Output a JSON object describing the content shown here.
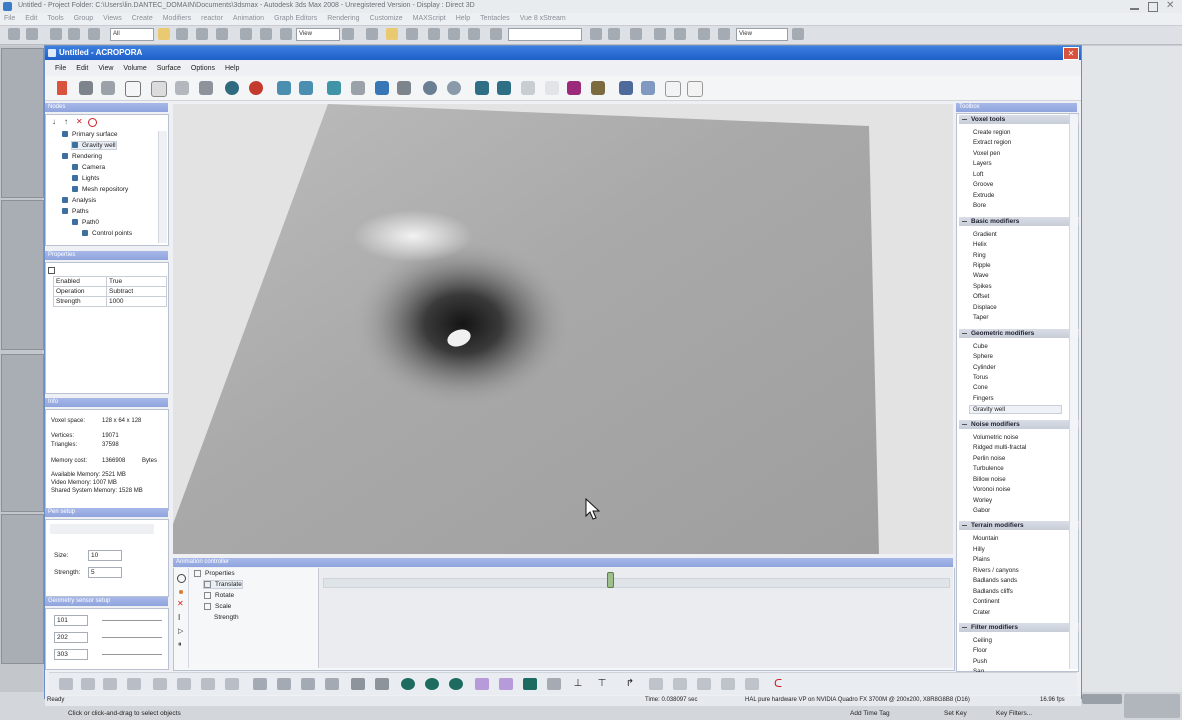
{
  "host": {
    "title": "Untitled    - Project Folder: C:\\Users\\lin.DANTEC_DOMAIN\\Documents\\3dsmax    - Autodesk 3ds Max 2008    - Unregistered Version    - Display : Direct 3D",
    "menu": [
      "File",
      "Edit",
      "Tools",
      "Group",
      "Views",
      "Create",
      "Modifiers",
      "reactor",
      "Animation",
      "Graph Editors",
      "Rendering",
      "Customize",
      "MAXScript",
      "Help",
      "Tentacles",
      "Vue 8 xStream"
    ],
    "toolbar_select": "All",
    "toolbar_view1": "View",
    "toolbar_view2": "View",
    "status_prompt": "Click or click-and-drag to select objects",
    "add_time_tag": "Add Time Tag",
    "set_key": "Set Key",
    "key_filters": "Key Filters..."
  },
  "app": {
    "title": "Untitled - ACROPORA",
    "menu": [
      "File",
      "Edit",
      "View",
      "Volume",
      "Surface",
      "Options",
      "Help"
    ],
    "close_glyph": "✕"
  },
  "nodes_panel": {
    "header": "Nodes",
    "tree": [
      {
        "label": "Primary surface",
        "indent": 1,
        "icon": "surface-icon"
      },
      {
        "label": "Gravity well",
        "indent": 2,
        "icon": "gravity-icon",
        "selected": true
      },
      {
        "label": "Rendering",
        "indent": 1,
        "icon": "rendering-icon"
      },
      {
        "label": "Camera",
        "indent": 2,
        "icon": "camera-icon"
      },
      {
        "label": "Lights",
        "indent": 2,
        "icon": "light-icon"
      },
      {
        "label": "Mesh repository",
        "indent": 2,
        "icon": "mesh-icon"
      },
      {
        "label": "Analysis",
        "indent": 1,
        "icon": "sigma-icon"
      },
      {
        "label": "Paths",
        "indent": 1,
        "icon": "path-icon"
      },
      {
        "label": "Path0",
        "indent": 2,
        "icon": "path-icon"
      },
      {
        "label": "Control points",
        "indent": 3,
        "icon": "path-icon"
      }
    ]
  },
  "properties_panel": {
    "header": "Properties",
    "rows": [
      {
        "name": "Enabled",
        "value": "True"
      },
      {
        "name": "Operation",
        "value": "Subtract"
      },
      {
        "name": "Strength",
        "value": "1000"
      }
    ]
  },
  "info_panel": {
    "header": "Info",
    "voxel_space_label": "Voxel space:",
    "voxel_space": "128 x 64 x 128",
    "vertices_label": "Vertices:",
    "vertices": "19071",
    "triangles_label": "Triangles:",
    "triangles": "37598",
    "memory_cost_label": "Memory cost:",
    "memory_cost": "1366908",
    "memory_unit": "Bytes",
    "available_memory": "Available Memory: 2521 MB",
    "video_memory": "Video Memory: 1007 MB",
    "shared_memory": "Shared System Memory: 1528 MB"
  },
  "pen_panel": {
    "header": "Pen setup",
    "size_label": "Size:",
    "size": "10",
    "strength_label": "Strength:",
    "strength": "5"
  },
  "sel_panel": {
    "header": "Geometry sensor setup",
    "values": [
      "101",
      "202",
      "303"
    ]
  },
  "toolbox": {
    "header": "Toolbox",
    "sections": [
      {
        "title": "Voxel tools",
        "items": [
          "Create region",
          "Extract region",
          "Voxel pen",
          "Layers",
          "Loft",
          "Groove",
          "Extrude",
          "Bore"
        ]
      },
      {
        "title": "Basic modifiers",
        "items": [
          "Gradient",
          "Helix",
          "Ring",
          "Ripple",
          "Wave",
          "Spikes",
          "Offset",
          "Displace",
          "Taper"
        ]
      },
      {
        "title": "Geometric modifiers",
        "items": [
          "Cube",
          "Sphere",
          "Cylinder",
          "Torus",
          "Cone",
          "Fingers",
          "Gravity well"
        ]
      },
      {
        "title": "Noise modifiers",
        "items": [
          "Volumetric noise",
          "Ridged multi-fractal",
          "Perlin noise",
          "Turbulence",
          "Billow noise",
          "Voronoi noise",
          "Worley",
          "Gabor"
        ]
      },
      {
        "title": "Terrain modifiers",
        "items": [
          "Mountain",
          "Hilly",
          "Plains",
          "Rivers / canyons",
          "Badlands sands",
          "Badlands cliffs",
          "Continent",
          "Crater"
        ]
      },
      {
        "title": "Filter modifiers",
        "items": [
          "Ceiling",
          "Floor",
          "Push",
          "Sag"
        ]
      }
    ],
    "selected_item": "Gravity well"
  },
  "animation": {
    "header": "Animation controller",
    "tree": [
      {
        "label": "Properties",
        "indent": 0
      },
      {
        "label": "Translate",
        "indent": 1,
        "selected": true
      },
      {
        "label": "Rotate",
        "indent": 1
      },
      {
        "label": "Scale",
        "indent": 1
      },
      {
        "label": "Strength",
        "indent": 2
      }
    ]
  },
  "status": {
    "left": "Ready",
    "time": "Time: 0.038097 sec",
    "renderer": "HAL pure hardware VP on NVIDIA Quadro FX 3700M @ 200x200, X8R8G8B8 (D16)",
    "fps": "16.96 fps"
  },
  "colors": {
    "accent": "#1f5fc7",
    "panel_header": "#94a8e0",
    "selection": "#e9edf4"
  }
}
